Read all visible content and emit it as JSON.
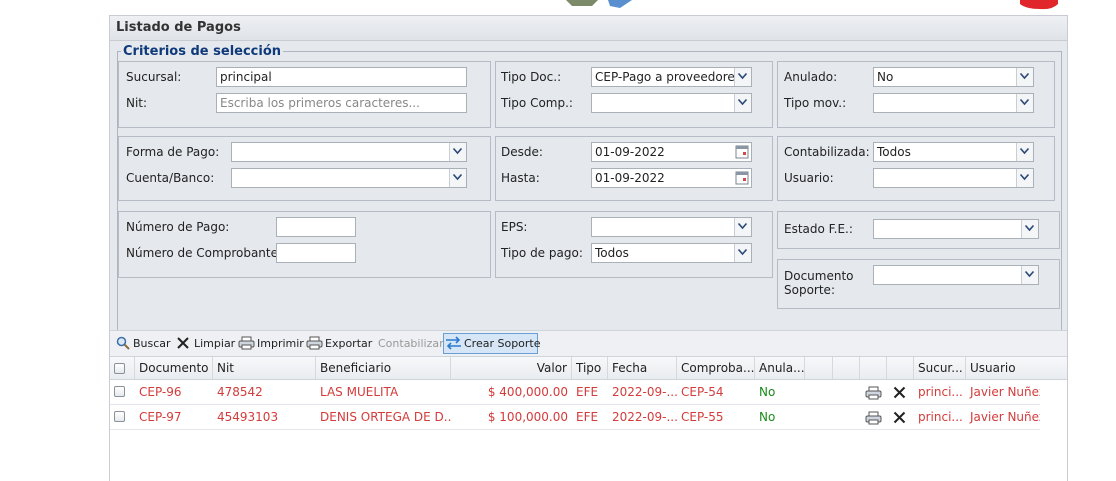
{
  "panel_title": "Listado de Pagos",
  "criteria": {
    "legend": "Criterios de selección",
    "sucursal_label": "Sucursal:",
    "sucursal_value": "principal",
    "nit_label": "Nit:",
    "nit_placeholder": "Escriba los primeros caracteres...",
    "tipo_doc_label": "Tipo Doc.:",
    "tipo_doc_value": "CEP-Pago a proveedores",
    "tipo_comp_label": "Tipo Comp.:",
    "tipo_comp_value": "",
    "anulado_label": "Anulado:",
    "anulado_value": "No",
    "tipo_mov_label": "Tipo mov.:",
    "tipo_mov_value": "",
    "forma_pago_label": "Forma de Pago:",
    "forma_pago_value": "",
    "cuenta_banco_label": "Cuenta/Banco:",
    "cuenta_banco_value": "",
    "desde_label": "Desde:",
    "desde_value": "01-09-2022",
    "hasta_label": "Hasta:",
    "hasta_value": "01-09-2022",
    "contabilizada_label": "Contabilizada:",
    "contabilizada_value": "Todos",
    "usuario_label": "Usuario:",
    "usuario_value": "",
    "numero_pago_label": "Número de Pago:",
    "numero_pago_value": "",
    "numero_comprobante_label": "Número de Comprobante:",
    "numero_comprobante_value": "",
    "eps_label": "EPS:",
    "eps_value": "",
    "tipo_pago_label": "Tipo de pago:",
    "tipo_pago_value": "Todos",
    "estado_fe_label": "Estado F.E.:",
    "estado_fe_value": "",
    "documento_soporte_label_1": "Documento",
    "documento_soporte_label_2": "Soporte:",
    "documento_soporte_value": ""
  },
  "toolbar": {
    "buscar": "Buscar",
    "limpiar": "Limpiar",
    "imprimir": "Imprimir",
    "exportar": "Exportar",
    "contabilizar": "Contabilizar",
    "crear_soporte": "Crear Soporte"
  },
  "grid": {
    "columns": [
      "Documento",
      "Nit",
      "Beneficiario",
      "Valor",
      "Tipo",
      "Fecha",
      "Comproba...",
      "Anula...",
      "Sucur...",
      "Usuario"
    ],
    "rows": [
      {
        "documento": "CEP-96",
        "nit": "478542",
        "beneficiario": "LAS MUELITA",
        "valor": "$ 400,000.00",
        "tipo": "EFE",
        "fecha": "2022-09-...",
        "comprobante": "CEP-54",
        "anulado": "No",
        "sucursal": "princi...",
        "usuario": "Javier Nuñez"
      },
      {
        "documento": "CEP-97",
        "nit": "45493103",
        "beneficiario": "DENIS ORTEGA DE D...",
        "valor": "$ 100,000.00",
        "tipo": "EFE",
        "fecha": "2022-09-...",
        "comprobante": "CEP-55",
        "anulado": "No",
        "sucursal": "princi...",
        "usuario": "Javier Nuñez"
      }
    ]
  },
  "colors": {
    "row_text": "#d43b3b",
    "anulado_text": "#1a8a1a",
    "legend_text": "#0f3a7a",
    "criteria_bg": "#e5e8ed"
  }
}
